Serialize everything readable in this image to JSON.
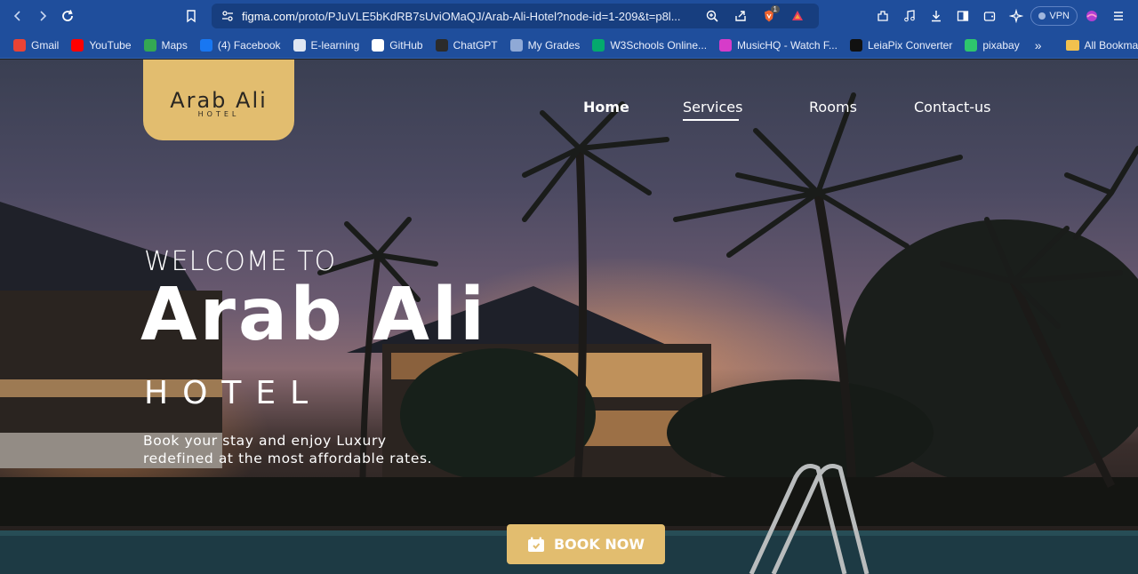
{
  "browser": {
    "url_host": "figma.com",
    "url_path": "/proto/PJuVLE5bKdRB7sUviOMaQJ/Arab-Ali-Hotel?node-id=1-209&t=p8l...",
    "vpn_label": "VPN",
    "brave_badge": "1"
  },
  "bookmarks": [
    {
      "label": "Gmail",
      "icon": "gmail-icon",
      "color": "#ea4335"
    },
    {
      "label": "YouTube",
      "icon": "youtube-icon",
      "color": "#ff0000"
    },
    {
      "label": "Maps",
      "icon": "maps-icon",
      "color": "#34a853"
    },
    {
      "label": "(4) Facebook",
      "icon": "facebook-icon",
      "color": "#1877f2"
    },
    {
      "label": "E-learning",
      "icon": "elearning-icon",
      "color": "#dfe6f2"
    },
    {
      "label": "GitHub",
      "icon": "github-icon",
      "color": "#ffffff"
    },
    {
      "label": "ChatGPT",
      "icon": "chatgpt-icon",
      "color": "#2b2b2b"
    },
    {
      "label": "My Grades",
      "icon": "grades-icon",
      "color": "#8fa9d6"
    },
    {
      "label": "W3Schools Online...",
      "icon": "w3schools-icon",
      "color": "#04aa6d"
    },
    {
      "label": "MusicHQ - Watch F...",
      "icon": "musichq-icon",
      "color": "#d63cc9"
    },
    {
      "label": "LeiaPix Converter",
      "icon": "leiapix-icon",
      "color": "#111111"
    },
    {
      "label": "pixabay",
      "icon": "pixabay-icon",
      "color": "#2ec66d"
    }
  ],
  "bookmarks_all": "All Bookmarks",
  "site": {
    "logo_main": "Arab Ali",
    "logo_sub": "HOTEL",
    "nav": {
      "home": "Home",
      "services": "Services",
      "rooms": "Rooms",
      "contact": "Contact-us"
    },
    "welcome": "WELCOME TO",
    "brand": "Arab Ali",
    "hotel": "HOTEL",
    "tagline_1": "Book your stay and enjoy Luxury",
    "tagline_2": "redefined at the most affordable rates.",
    "book_button": "BOOK NOW",
    "accent_color": "#e2bd6f"
  }
}
